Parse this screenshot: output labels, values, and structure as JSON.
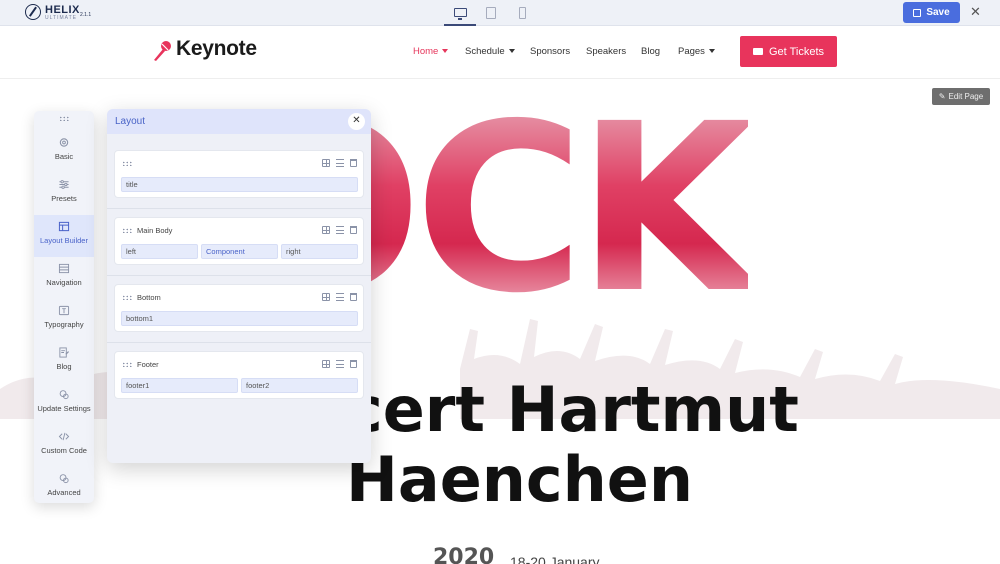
{
  "toolbar": {
    "app_name": "HELIX",
    "app_subtitle": "ULTIMATE",
    "version": "2.1.1",
    "devices": [
      "desktop-icon",
      "tablet-icon",
      "mobile-icon"
    ],
    "active_device": "desktop",
    "save_label": "Save",
    "close_label": "✕"
  },
  "site": {
    "brand": "Keynote",
    "nav": [
      {
        "label": "Home",
        "dropdown": true,
        "active": true
      },
      {
        "label": "Schedule",
        "dropdown": true,
        "active": false
      },
      {
        "label": "Sponsors",
        "dropdown": false,
        "active": false
      },
      {
        "label": "Speakers",
        "dropdown": false,
        "active": false
      },
      {
        "label": "Blog",
        "dropdown": false,
        "active": false
      },
      {
        "label": "Pages",
        "dropdown": true,
        "active": false
      }
    ],
    "cta_label": "Get Tickets",
    "accent_color": "#e8345c"
  },
  "hero": {
    "edit_page_label": "Edit Page",
    "big_word": "OCK",
    "title_line1": "cert Hartmut",
    "title_line2": "Haenchen",
    "year": "2020",
    "dates": "18-20 January"
  },
  "sidebar": {
    "items": [
      {
        "label": "Basic",
        "icon": "gear-icon",
        "active": false
      },
      {
        "label": "Presets",
        "icon": "sliders-icon",
        "active": false
      },
      {
        "label": "Layout Builder",
        "icon": "layout-icon",
        "active": true
      },
      {
        "label": "Navigation",
        "icon": "menu-list-icon",
        "active": false
      },
      {
        "label": "Typography",
        "icon": "text-icon",
        "active": false
      },
      {
        "label": "Blog",
        "icon": "document-edit-icon",
        "active": false
      },
      {
        "label": "Update Settings",
        "icon": "update-icon",
        "active": false
      },
      {
        "label": "Custom Code",
        "icon": "code-icon",
        "active": false
      },
      {
        "label": "Advanced",
        "icon": "advanced-icon",
        "active": false
      }
    ]
  },
  "layout_panel": {
    "title": "Layout",
    "close_label": "✕",
    "rows": [
      {
        "name": "",
        "columns": [
          {
            "label": "title",
            "highlight": false
          }
        ]
      },
      {
        "name": "Main Body",
        "columns": [
          {
            "label": "left",
            "highlight": false
          },
          {
            "label": "Component",
            "highlight": true
          },
          {
            "label": "right",
            "highlight": false
          }
        ]
      },
      {
        "name": "Bottom",
        "columns": [
          {
            "label": "bottom1",
            "highlight": false
          }
        ]
      },
      {
        "name": "Footer",
        "columns": [
          {
            "label": "footer1",
            "highlight": false
          },
          {
            "label": "footer2",
            "highlight": false
          }
        ]
      }
    ]
  }
}
